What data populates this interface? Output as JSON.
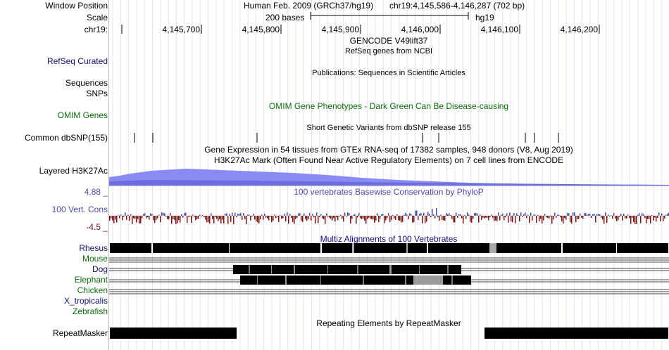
{
  "header": {
    "window_position_label": "Window Position",
    "scale_label": "Scale",
    "chrom_label": "chr19:",
    "assembly_text": "Human Feb. 2009 (GRCh37/hg19)",
    "position_text": "chr19:4,145,586-4,146,287 (702 bp)",
    "scale_text": "200 bases",
    "db_text": "hg19",
    "ruler_ticks": [
      "4,145,700",
      "4,145,800",
      "4,145,900",
      "4,146,000",
      "4,146,100",
      "4,146,200"
    ]
  },
  "labels": {
    "refseq": "RefSeq Curated",
    "sequences": "Sequences",
    "snps": "SNPs",
    "omim": "OMIM Genes",
    "dbsnp": "Common dbSNP(155)",
    "h3k27ac": "Layered H3K27Ac",
    "cons_max": "4.88 _",
    "cons": "100 Vert. Cons",
    "cons_min": "-4.5 _",
    "species": [
      "Rhesus",
      "Mouse",
      "Dog",
      "Elephant",
      "Chicken",
      "X_tropicalis",
      "Zebrafish"
    ],
    "repeatmasker": "RepeatMasker"
  },
  "centers": {
    "gencode": "GENCODE V49lift37",
    "refseq_sub": "RefSeq genes from NCBI",
    "publications": "Publications: Sequences in Scientific Articles",
    "omim": "OMIM Gene Phenotypes - Dark Green Can Be Disease-causing",
    "dbsnp": "Short Genetic Variants from dbSNP release 155",
    "gtex": "Gene Expression in 54 tissues from GTEx RNA-seq of 17382 samples, 948 donors (V8, Aug 2019)",
    "h3k27ac": "H3K27Ac Mark (Often Found Near Active Regulatory Elements) on 7 cell lines from ENCODE",
    "phylop": "100 vertebrates Basewise Conservation by PhyloP",
    "multiz": "Multiz Alignments of 100 Vertebrates",
    "repeatmasker": "Repeating Elements by RepeatMasker"
  },
  "colors": {
    "label_blue": "#10106e",
    "label_green": "#0c6e0c",
    "cons_blue": "#4b4ba8",
    "cons_red": "#7a1818",
    "h3k27ac_fill": "#8a8af5"
  }
}
